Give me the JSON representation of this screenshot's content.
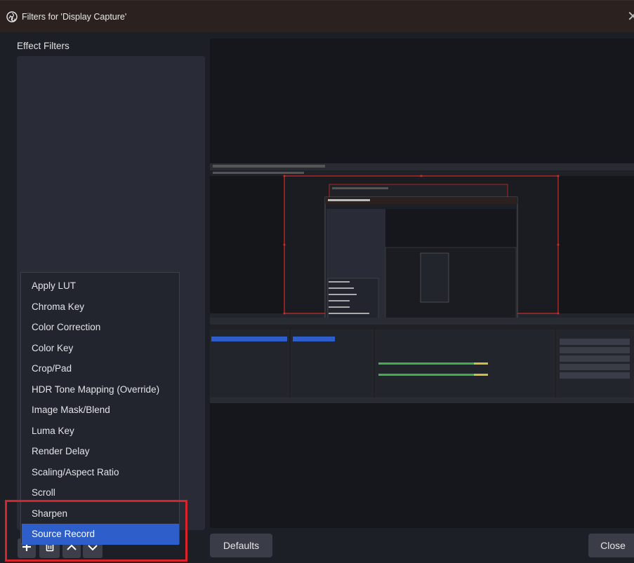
{
  "window": {
    "title": "Filters for 'Display Capture'",
    "close_glyph": "✕"
  },
  "left_panel": {
    "label": "Effect Filters"
  },
  "filter_menu": {
    "items": [
      {
        "label": "Apply LUT",
        "selected": false
      },
      {
        "label": "Chroma Key",
        "selected": false
      },
      {
        "label": "Color Correction",
        "selected": false
      },
      {
        "label": "Color Key",
        "selected": false
      },
      {
        "label": "Crop/Pad",
        "selected": false
      },
      {
        "label": "HDR Tone Mapping (Override)",
        "selected": false
      },
      {
        "label": "Image Mask/Blend",
        "selected": false
      },
      {
        "label": "Luma Key",
        "selected": false
      },
      {
        "label": "Render Delay",
        "selected": false
      },
      {
        "label": "Scaling/Aspect Ratio",
        "selected": false
      },
      {
        "label": "Scroll",
        "selected": false
      },
      {
        "label": "Sharpen",
        "selected": false
      },
      {
        "label": "Source Record",
        "selected": true
      }
    ]
  },
  "toolbar": {
    "add_icon": "plus-icon",
    "remove_icon": "trash-icon",
    "up_icon": "chevron-up-icon",
    "down_icon": "chevron-down-icon"
  },
  "buttons": {
    "defaults": "Defaults",
    "close": "Close"
  },
  "colors": {
    "accent": "#2d5ec9",
    "highlight": "#d8232a",
    "titlebar": "#2b211e",
    "background": "#1d1f26"
  }
}
